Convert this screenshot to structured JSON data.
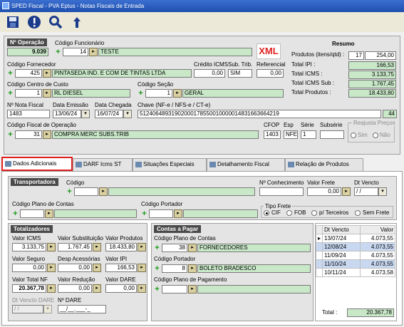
{
  "app": {
    "title": "SPED Fiscal - PVA Eptus - Notas Fiscais de Entrada"
  },
  "toolbar": {
    "icons": [
      "save-icon",
      "info-icon",
      "search-icon",
      "back-icon"
    ]
  },
  "header": {
    "operacao_label": "Nº Operação",
    "operacao_value": "9.039",
    "funcionario_label": "Código Funcionário",
    "funcionario_code": "14",
    "funcionario_name": "TESTE",
    "xml_label": "XML",
    "fornecedor_label": "Código Fornecedor",
    "fornecedor_code": "425",
    "fornecedor_name": "PINTASEDA IND. E COM DE TINTAS LTDA",
    "credito_label": "Crédito ICMS",
    "credito_value": "0,00",
    "subtrib_label": "Sub. Trib.",
    "subtrib_value": "SIM",
    "referencial_label": "Referencial",
    "referencial_value": "0,00",
    "centro_label": "Código Centro de Custo",
    "centro_code": "1",
    "centro_name": "RL DIESEL",
    "secao_label": "Código Seção",
    "secao_code": "1",
    "secao_name": "GERAL",
    "nf_label": "Nº Nota Fiscal",
    "nf_value": "1483",
    "emissao_label": "Data Emissão",
    "emissao_value": "13/06/24",
    "chegada_label": "Data Chegada",
    "chegada_value": "16/07/24",
    "chave_label": "Chave (NF-e / NFS-e / CT-e)",
    "chave_value": "51240648931902000178550010000014831663664219",
    "chave_suffix": "44",
    "fiscal_label": "Código Fiscal de Operação",
    "fiscal_code": "31",
    "fiscal_name": "COMPRA MERC SUBS.TRIB",
    "cfop_label": "CFOP",
    "cfop_value": "1403",
    "esp_label": "Esp",
    "esp_value": "NFE",
    "serie_label": "Série",
    "serie_value": "1",
    "subserie_label": "Subsérie",
    "subserie_value": "",
    "reajusta_label": "Reajusta Preços",
    "sim_label": "Sim",
    "nao_label": "Não"
  },
  "resumo": {
    "title": "Resumo",
    "produtos_label": "Produtos (itens/qtd) :",
    "produtos_itens": "17",
    "produtos_qtd": "254,00",
    "ipi_label": "Total IPI :",
    "ipi_value": "166,53",
    "icms_label": "Total ICMS :",
    "icms_value": "3.133,75",
    "icmssub_label": "Total ICMS Sub :",
    "icmssub_value": "1.767,45",
    "totalprod_label": "Total Produtos :",
    "totalprod_value": "18.433,80"
  },
  "tabs": [
    {
      "label": "Dados Adicionais"
    },
    {
      "label": "DARF Icms ST"
    },
    {
      "label": "Situações Especiais"
    },
    {
      "label": "Detalhamento Fiscal"
    },
    {
      "label": "Relação de Produtos"
    }
  ],
  "transportadora": {
    "title": "Transportadora",
    "codigo_label": "Código",
    "codigo_value": "",
    "conhecimento_label": "Nº Conhecimento",
    "conhecimento_value": "",
    "frete_label": "Valor Frete",
    "frete_value": "0,00",
    "vencto_label": "Dt Vencto",
    "vencto_value": "/ /",
    "plano_label": "Código Plano de Contas",
    "portador_label": "Código Portador",
    "tipofrete_label": "Tipo Frete",
    "cif": "CIF",
    "fob": "FOB",
    "terceiros": "p/ Terceiros",
    "semfrete": "Sem Frete"
  },
  "totalizadores": {
    "title": "Totalizadores",
    "vicms_label": "Valor ICMS",
    "vicms_value": "3.133,75",
    "vsub_label": "Valor Substituição",
    "vsub_value": "1.767,45",
    "vprod_label": "Valor Produtos",
    "vprod_value": "18.433,80",
    "vseguro_label": "Valor Seguro",
    "vseguro_value": "0,00",
    "desp_label": "Desp Acessórias",
    "desp_value": "0,00",
    "vipi_label": "Valor IPI",
    "vipi_value": "166,53",
    "vtotal_label": "Valor Total NF",
    "vtotal_value": "20.367,78",
    "vred_label": "Valor Redução",
    "vred_value": "0,00",
    "vdare_label": "Valor DARE",
    "vdare_value": "0,00",
    "dtdare_label": "Dt Vencto DARE",
    "dtdare_value": "/ /",
    "ndare_label": "Nº DARE",
    "ndare_value": "__/__.___-_"
  },
  "contas": {
    "title": "Contas a Pagar",
    "plano_label": "Código Plano de Contas",
    "plano_code": "38",
    "plano_name": "FORNECEDORES",
    "portador_label": "Código Portador",
    "portador_code": "8",
    "portador_name": "BOLETO BRADESCO",
    "pagamento_label": "Código Plano de Pagamento",
    "pagamento_code": ""
  },
  "parcelas": {
    "col_vencto": "Dt Vencto",
    "col_valor": "Valor",
    "rows": [
      {
        "vencto": "13/07/24",
        "valor": "4.073,55"
      },
      {
        "vencto": "12/08/24",
        "valor": "4.073,55"
      },
      {
        "vencto": "11/09/24",
        "valor": "4.073,55"
      },
      {
        "vencto": "11/10/24",
        "valor": "4.073,55"
      },
      {
        "vencto": "10/11/24",
        "valor": "4.073,58"
      }
    ],
    "total_label": "Total :",
    "total_value": "20.367,78"
  }
}
